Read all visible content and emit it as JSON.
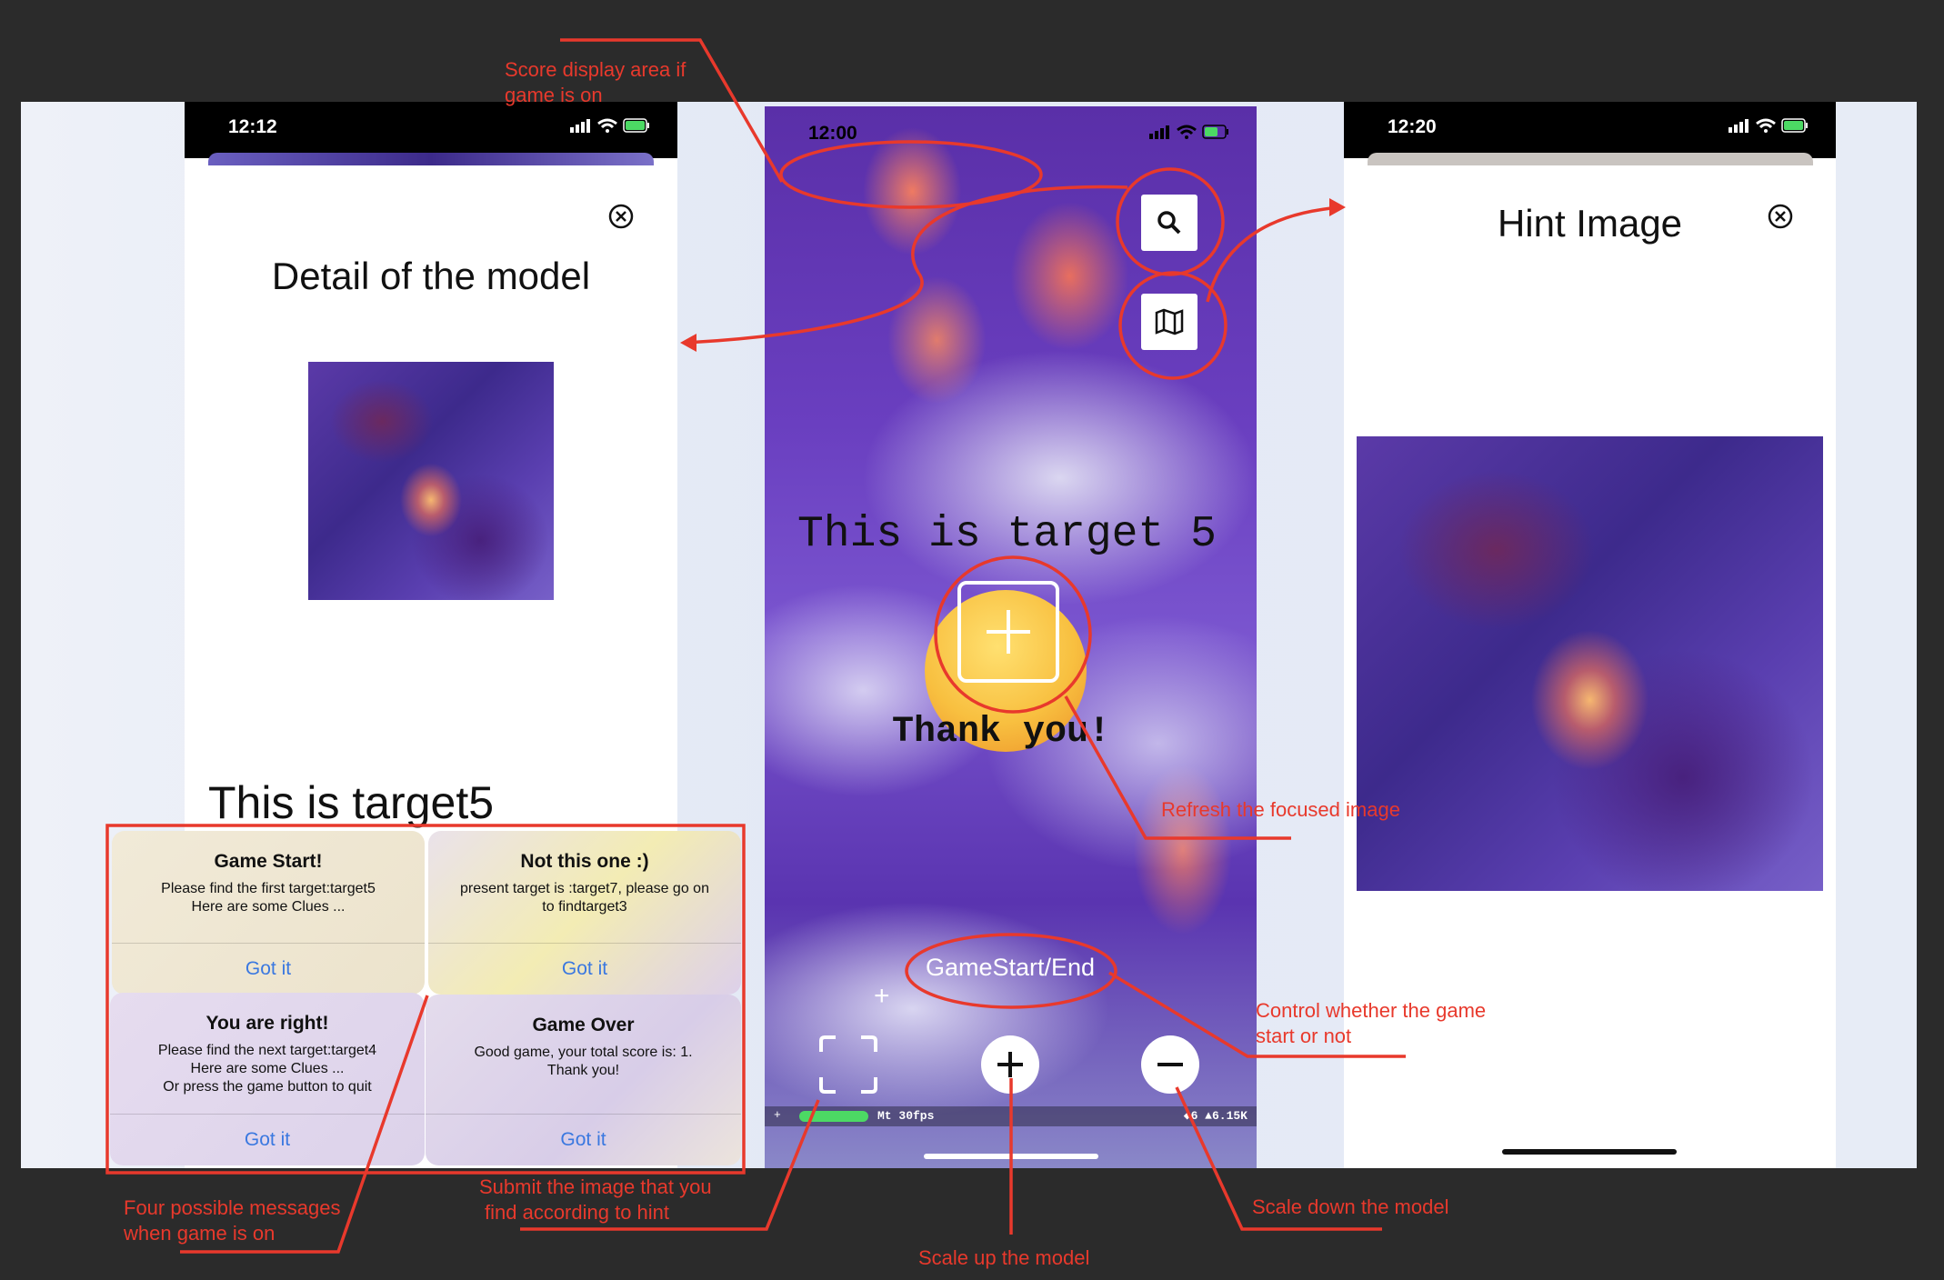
{
  "left_phone": {
    "time": "12:12",
    "sheet_title": "Detail of the model",
    "target_text": "This is target5"
  },
  "center_phone": {
    "time": "12:00",
    "ar_label_1": "This is target 5",
    "ar_label_2": "Thank you!",
    "game_button": "GameStart/End",
    "debug_left": "Mt 30fps",
    "debug_right": "◆6 ▲6.15K"
  },
  "right_phone": {
    "time": "12:20",
    "sheet_title": "Hint Image"
  },
  "alerts": [
    {
      "title": "Game Start!",
      "message_1": "Please find the first target:target5",
      "message_2": "Here are some Clues ...",
      "message_3": "",
      "button": "Got it"
    },
    {
      "title": "Not this one :)",
      "message_1": "present target is :target7, please go on",
      "message_2": "to findtarget3",
      "message_3": "",
      "button": "Got it"
    },
    {
      "title": "You are right!",
      "message_1": "Please find the next target:target4",
      "message_2": "Here are some Clues ...",
      "message_3": "Or press the game button to quit",
      "button": "Got it"
    },
    {
      "title": "Game Over",
      "message_1": "Good game, your total score is: 1.",
      "message_2": "Thank you!",
      "message_3": "",
      "button": "Got it"
    }
  ],
  "annotations": {
    "score_area_1": "Score display area if",
    "score_area_2": "game is on",
    "refresh": "Refresh the focused image",
    "control_1": "Control whether the game",
    "control_2": "start or not",
    "four_messages_1": "Four possible messages",
    "four_messages_2": "when game is on",
    "submit_1": "Submit the image that you",
    "submit_2": "find according to hint",
    "scale_up": "Scale up the model",
    "scale_down": "Scale down the model"
  },
  "colors": {
    "annotation": "#e8392c",
    "alert_button": "#3a78e0",
    "background": "#2b2b2b"
  }
}
